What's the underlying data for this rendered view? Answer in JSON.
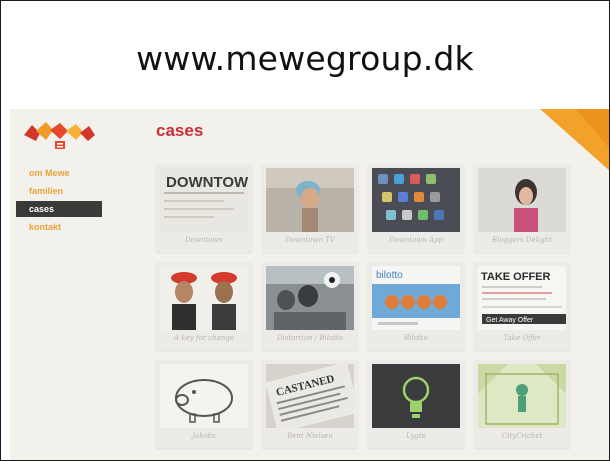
{
  "slide": {
    "title": "www.mewegroup.dk"
  },
  "site": {
    "heading": "cases",
    "nav": [
      {
        "label": "om Mewe",
        "active": false
      },
      {
        "label": "familien",
        "active": false
      },
      {
        "label": "cases",
        "active": true
      },
      {
        "label": "kontakt",
        "active": false
      }
    ],
    "colors": {
      "accent": "#c92f36",
      "nav": "#e8a33c",
      "nav_active_bg": "#3a3a38",
      "corner": "#f2a12a"
    },
    "cases": [
      {
        "caption": "Downtown",
        "thumb_text": "DOWNTOWN"
      },
      {
        "caption": "Downtown TV",
        "thumb_text": ""
      },
      {
        "caption": "Downtown App",
        "thumb_text": ""
      },
      {
        "caption": "Bloggers Delight",
        "thumb_text": ""
      },
      {
        "caption": "A key for change",
        "thumb_text": ""
      },
      {
        "caption": "Distortion / Bilotto",
        "thumb_text": ""
      },
      {
        "caption": "Bilotto",
        "thumb_text": "bilotto"
      },
      {
        "caption": "Take Offer",
        "thumb_text": "TAKE OFFER",
        "thumb_sub": "Get Away Offer"
      },
      {
        "caption": "Jakobs",
        "thumb_text": ""
      },
      {
        "caption": "Bent Nielsen",
        "thumb_text": "CASTANED"
      },
      {
        "caption": "Lygte",
        "thumb_text": ""
      },
      {
        "caption": "CityCricket",
        "thumb_text": ""
      }
    ]
  }
}
